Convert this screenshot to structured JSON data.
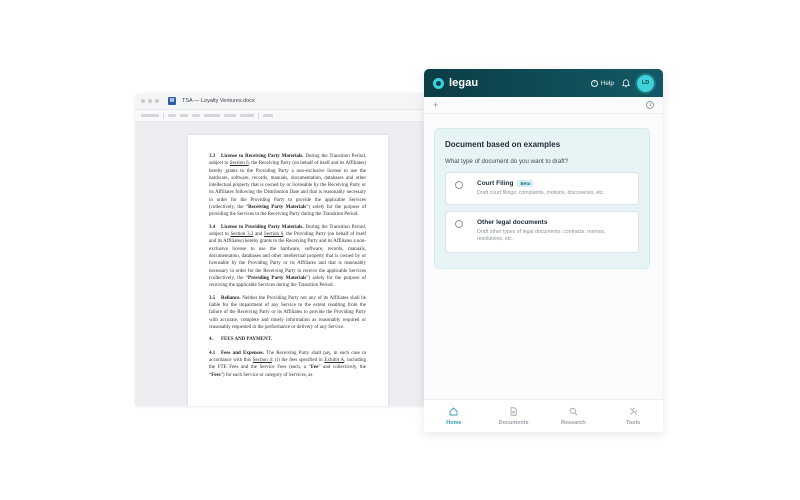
{
  "word": {
    "title": "TSA — Loyalty Ventures.docx",
    "doc_icon_letter": "W",
    "paragraphs": {
      "p33_num": "3.3",
      "p33_head": "License to Receiving Party Materials.",
      "p33_a": " During the Transition Period, subject to ",
      "p33_link": "Section 6",
      "p33_b": ", the Receiving Party (on behalf of itself and its Affiliates) hereby grants to the Providing Party a non-exclusive license to use the hardware, software, records, manuals, documentation, databases and other intellectual property that is owned by or licensable by the Receiving Party or its Affiliates following the Distribution Date and that is reasonably necessary in order for the Providing Party to provide the applicable Services (collectively, the “",
      "p33_term": "Receiving Party Materials",
      "p33_c": "”) solely for the purpose of providing the Services to the Receiving Party during the Transition Period.",
      "p34_num": "3.4",
      "p34_head": "License to Providing Party Materials.",
      "p34_a": " During the Transition Period, subject to ",
      "p34_link1": "Section 3.2",
      "p34_mid": " and ",
      "p34_link2": "Section 6",
      "p34_b": ", the Providing Party (on behalf of itself and its Affiliates) hereby grants to the Receiving Party and its Affiliates a non-exclusive license to use the hardware, software, records, manuals, documentation, databases and other intellectual property that is owned by or licensable by the Providing Party or its Affiliates and that is reasonably necessary in order for the Receiving Party to receive the applicable Services (collectively, the “",
      "p34_term": "Providing Party Materials",
      "p34_c": "”) solely for the purpose of receiving the applicable Services during the Transition Period.",
      "p35_num": "3.5",
      "p35_head": "Reliance.",
      "p35_body": " Neither the Providing Party nor any of its Affiliates shall be liable for the impairment of any Service to the extent resulting from the failure of the Receiving Party or its Affiliates to provide the Providing Party with accurate, complete and timely information as reasonably required or reasonably requested in the performance or delivery of any Service.",
      "s4_num": "4.",
      "s4_head": "FEES AND PAYMENT.",
      "p41_num": "4.1",
      "p41_head": "Fees and Expenses.",
      "p41_a": " The Receiving Party shall pay, in each case in accordance with this ",
      "p41_link1": "Section 4",
      "p41_b": ": (i) the fees specified in ",
      "p41_link2": "Exhibit A",
      "p41_c": ", including the FTE Fees and the Service Fees (each, a “",
      "p41_term1": "Fee",
      "p41_d": "” and collectively, the “",
      "p41_term2": "Fees",
      "p41_e": "”) for each Service or category of Services, as"
    }
  },
  "legau": {
    "brand": "legau",
    "help_label": "Help",
    "avatar_initials": "LD",
    "card": {
      "title": "Document based on examples",
      "question": "What type of document do you want to draft?",
      "options": [
        {
          "title": "Court Filing",
          "badge": "Beta",
          "desc": "Draft court filings: complaints, motions, discoveries, etc."
        },
        {
          "title": "Other legal documents",
          "desc": "Draft other types of legal documents: contracts, memos, resolutions, etc."
        }
      ]
    },
    "nav": [
      {
        "label": "Home",
        "icon": "home-icon",
        "active": true
      },
      {
        "label": "Documents",
        "icon": "document-icon",
        "active": false
      },
      {
        "label": "Research",
        "icon": "search-icon",
        "active": false
      },
      {
        "label": "Tools",
        "icon": "tools-icon",
        "active": false
      }
    ],
    "colors": {
      "header": "#0f4a54",
      "accent": "#3fd2da",
      "active_nav": "#2f9fb5",
      "card_bg": "#e7f4f6"
    }
  }
}
